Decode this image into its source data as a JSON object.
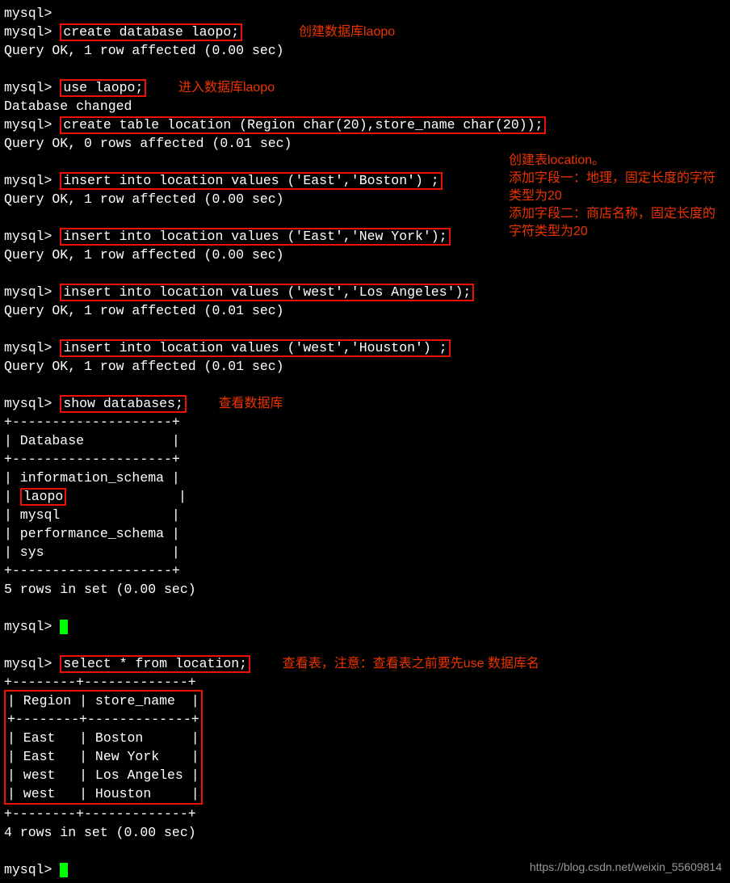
{
  "prompt": "mysql>",
  "cmd_create_db": "create database laopo;",
  "cmd_use": "use laopo;",
  "cmd_create_table": "create table location (Region char(20),store_name char(20));",
  "cmd_insert1": "insert into location values ('East','Boston') ;",
  "cmd_insert2": "insert into location values ('East','New York');",
  "cmd_insert3": "insert into location values ('west','Los Angeles');",
  "cmd_insert4": "insert into location values ('west','Houston') ;",
  "cmd_show_db": "show databases;",
  "cmd_select": "select * from location;",
  "res_ok_1row_000": "Query OK, 1 row affected (0.00 sec)",
  "res_ok_0row_001": "Query OK, 0 rows affected (0.01 sec)",
  "res_ok_1row_001": "Query OK, 1 row affected (0.01 sec)",
  "res_db_changed": "Database changed",
  "db_header_sep": "+--------------------+",
  "db_header": "| Database           |",
  "db_row_info": "| information_schema |",
  "db_row_laopo_pre": "| ",
  "db_row_laopo": "laopo",
  "db_row_laopo_post": "              |",
  "db_row_mysql": "| mysql              |",
  "db_row_perf": "| performance_schema |",
  "db_row_sys": "| sys                |",
  "db_rows_count": "5 rows in set (0.00 sec)",
  "tbl_sep": "+--------+-------------+",
  "tbl_header": "| Region | store_name  |",
  "tbl_row1": "| East   | Boston      |",
  "tbl_row2": "| East   | New York    |",
  "tbl_row3": "| west   | Los Angeles |",
  "tbl_row4": "| west   | Houston     |",
  "tbl_rows_count": "4 rows in set (0.00 sec)",
  "ann_create_db": "创建数据库laopo",
  "ann_use": "进入数据库laopo",
  "ann_ct1": "创建表location。",
  "ann_ct2": "添加字段一：地理，固定长度的字符类型为20",
  "ann_ct3": "添加字段二：商店名称，固定长度的字符类型为20",
  "ann_show_db": "查看数据库",
  "ann_select": "查看表，注意：查看表之前要先use 数据库名",
  "watermark": "https://blog.csdn.net/weixin_55609814"
}
